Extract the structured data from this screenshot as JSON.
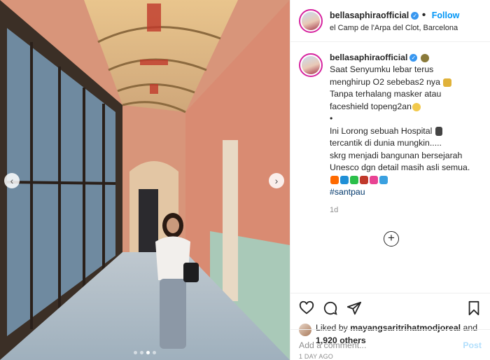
{
  "post": {
    "username": "bellasaphiraofficial",
    "verified_mark": "✓",
    "follow_label": "Follow",
    "dot_separator": "•",
    "location": "el Camp de l'Arpa del Clot, Barcelona"
  },
  "caption": {
    "lines": [
      "Saat Senyumku lebar terus",
      "menghirup O2 sebebas2 nya",
      "Tanpa terhalang masker atau",
      "faceshield topeng2an",
      "•",
      "Ini Lorong sebuah Hospital",
      "tercantik di dunia mungkin.....",
      "skrg menjadi bangunan bersejarah",
      "Unesco dgn detail masih asli semua."
    ],
    "emoji_row": [
      "#ff6a00",
      "#1f8fd6",
      "#2bbf4a",
      "#c0392b",
      "#e84393",
      "#3aa0e0"
    ],
    "hashtag": "#santpau",
    "age": "1d"
  },
  "icons": {
    "prev": "chevron-left-icon",
    "next": "chevron-right-icon",
    "add": "plus-circle-icon",
    "like": "heart-icon",
    "comment": "comment-icon",
    "share": "share-icon",
    "save": "bookmark-icon"
  },
  "nav": {
    "prev_glyph": "‹",
    "next_glyph": "›",
    "add_glyph": "+"
  },
  "carousel": {
    "count": 4,
    "active_index": 2
  },
  "likes": {
    "prefix": "Liked by",
    "user": "mayangsaritrihatmodjoreal",
    "joiner": "and",
    "others": "1,920 others"
  },
  "date_label": "1 DAY AGO",
  "comment_box": {
    "placeholder": "Add a comment...",
    "post_label": "Post"
  },
  "colors": {
    "accent": "#0095f6",
    "verified": "#3897f0",
    "ring": "#d6249f"
  }
}
